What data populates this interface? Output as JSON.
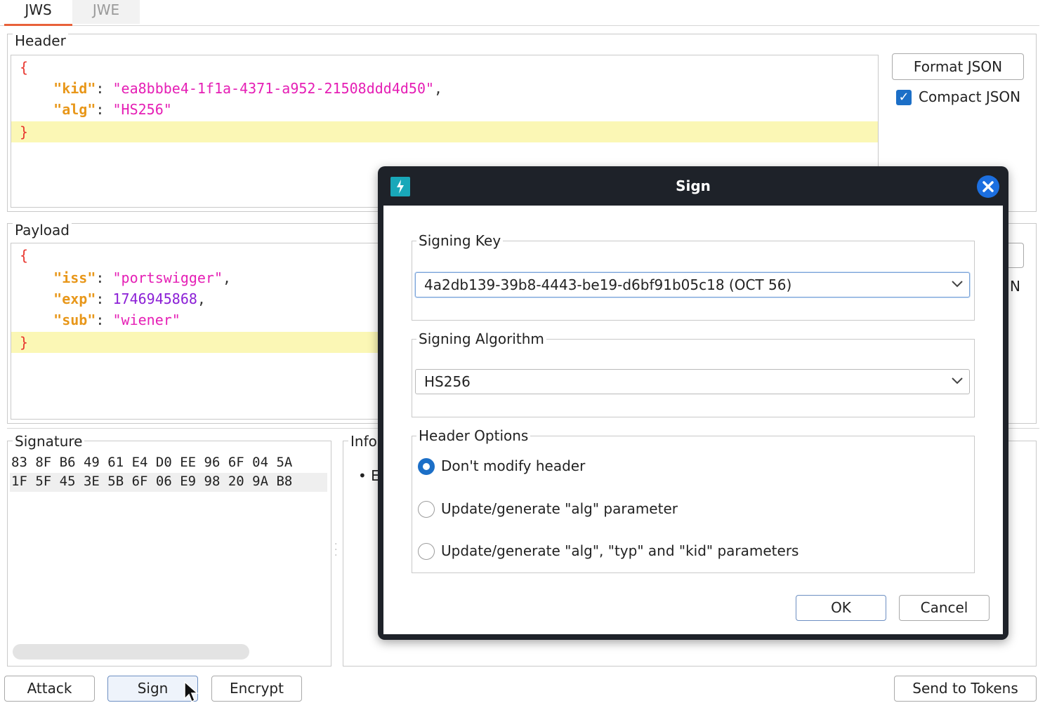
{
  "tabs": [
    "JWS",
    "JWE"
  ],
  "header_section": {
    "title": "Header",
    "lines": {
      "open": "{",
      "kid_key": "\"kid\"",
      "kid_value": "\"ea8bbbe4-1f1a-4371-a952-21508ddd4d50\"",
      "alg_key": "\"alg\"",
      "alg_value": "\"HS256\"",
      "close": "}"
    }
  },
  "right_panel": {
    "format_json": "Format JSON",
    "compact_json": "Compact JSON",
    "compact_json_checked": true,
    "payload_compact_partial": "N"
  },
  "payload_section": {
    "title": "Payload",
    "lines": {
      "open": "{",
      "iss_key": "\"iss\"",
      "iss_value": "\"portswigger\"",
      "exp_key": "\"exp\"",
      "exp_value": "1746945868",
      "sub_key": "\"sub\"",
      "sub_value": "\"wiener\"",
      "close": "}"
    }
  },
  "signature_section": {
    "title": "Signature",
    "hex_row_1": "83 8F B6 49 61 E4 D0 EE 96 6F 04 5A",
    "hex_row_2": "1F 5F 45 3E 5B 6F 06 E9 98 20 9A B8"
  },
  "info_section": {
    "title": "Info",
    "bullet_partial": "• E"
  },
  "bottom_buttons": {
    "attack": "Attack",
    "sign": "Sign",
    "encrypt": "Encrypt",
    "send_to_tokens": "Send to Tokens"
  },
  "dialog": {
    "title": "Sign",
    "signing_key_label": "Signing Key",
    "signing_key_value": "4a2db139-39b8-4443-be19-d6bf91b05c18 (OCT 56)",
    "signing_algorithm_label": "Signing Algorithm",
    "signing_algorithm_value": "HS256",
    "header_options_label": "Header Options",
    "options": [
      {
        "label": "Don't modify header",
        "selected": true
      },
      {
        "label": "Update/generate \"alg\" parameter",
        "selected": false
      },
      {
        "label": "Update/generate \"alg\", \"typ\" and \"kid\" parameters",
        "selected": false
      }
    ],
    "ok": "OK",
    "cancel": "Cancel"
  },
  "colors": {
    "accent_tab": "#e8613a",
    "checkbox": "#1c6fc7",
    "dialog_titlebar": "#1e2229",
    "line_highlight": "#fbf7b5"
  },
  "icons": {
    "dialog_app_icon": "lightning-icon",
    "dialog_close": "close-icon",
    "dropdown": "chevron-down-icon",
    "cursor": "mouse-pointer-icon"
  }
}
